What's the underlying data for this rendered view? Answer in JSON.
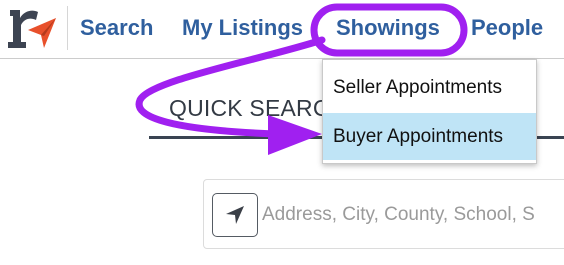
{
  "header": {
    "logo_icon": "realtor-r-arrow-logo",
    "nav": {
      "search": "Search",
      "my_listings": "My Listings",
      "showings": "Showings",
      "people": "People"
    }
  },
  "showings_menu": {
    "items": [
      "Seller Appointments",
      "Buyer Appointments"
    ],
    "highlighted": "Buyer Appointments"
  },
  "quick_search": {
    "heading": "QUICK SEARCH",
    "location_icon": "location-arrow-icon",
    "placeholder": "Address, City, County, School, S"
  },
  "annotation": {
    "color": "#a020f0",
    "icon": "curved-arrow-annotation"
  },
  "colors": {
    "nav_link": "#2f5f9e",
    "logo_dark": "#3d4452",
    "logo_accent": "#e8502b",
    "highlight": "#bfe4f6"
  }
}
